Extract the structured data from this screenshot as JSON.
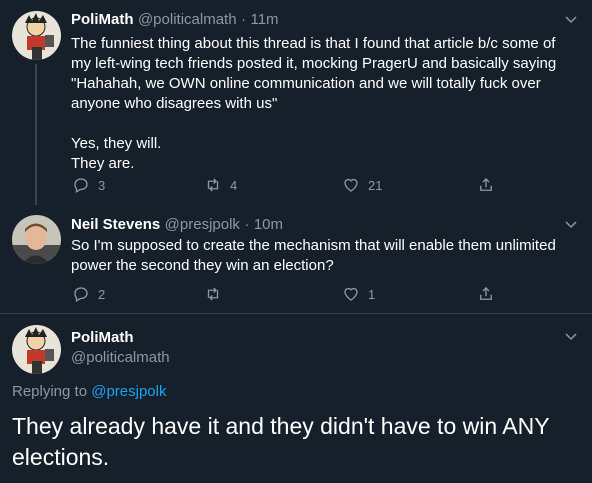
{
  "tweets": [
    {
      "name": "PoliMath",
      "handle": "@politicalmath",
      "time": "11m",
      "lines": [
        "The funniest thing about this thread is that I found that article b/c some of",
        "my left-wing tech friends posted it, mocking PragerU and basically saying",
        "\"Hahahah, we OWN online communication and we will totally fuck over",
        "anyone who disagrees with us\"",
        "",
        "Yes, they will.",
        "They are."
      ],
      "replies": "3",
      "retweets": "4",
      "likes": "21"
    },
    {
      "name": "Neil Stevens",
      "handle": "@presjpolk",
      "time": "10m",
      "lines": [
        "So I'm supposed to create the mechanism that will enable them unlimited",
        "power the second they win an election?"
      ],
      "replies": "2",
      "retweets": "",
      "likes": "1"
    }
  ],
  "focused": {
    "name": "PoliMath",
    "handle": "@politicalmath",
    "replying_prefix": "Replying to",
    "replying_to": "@presjpolk",
    "lines": [
      "They already have it and they didn't have to win ANY",
      "elections."
    ]
  },
  "separator": "·",
  "icons": {
    "reply": "reply-icon",
    "retweet": "retweet-icon",
    "like": "heart-icon",
    "share": "share-icon",
    "menu": "chevron-down-icon"
  },
  "colors": {
    "background": "#15202b",
    "secondary_text": "#8899a6",
    "link": "#1da1f2",
    "divider": "#38444d"
  }
}
